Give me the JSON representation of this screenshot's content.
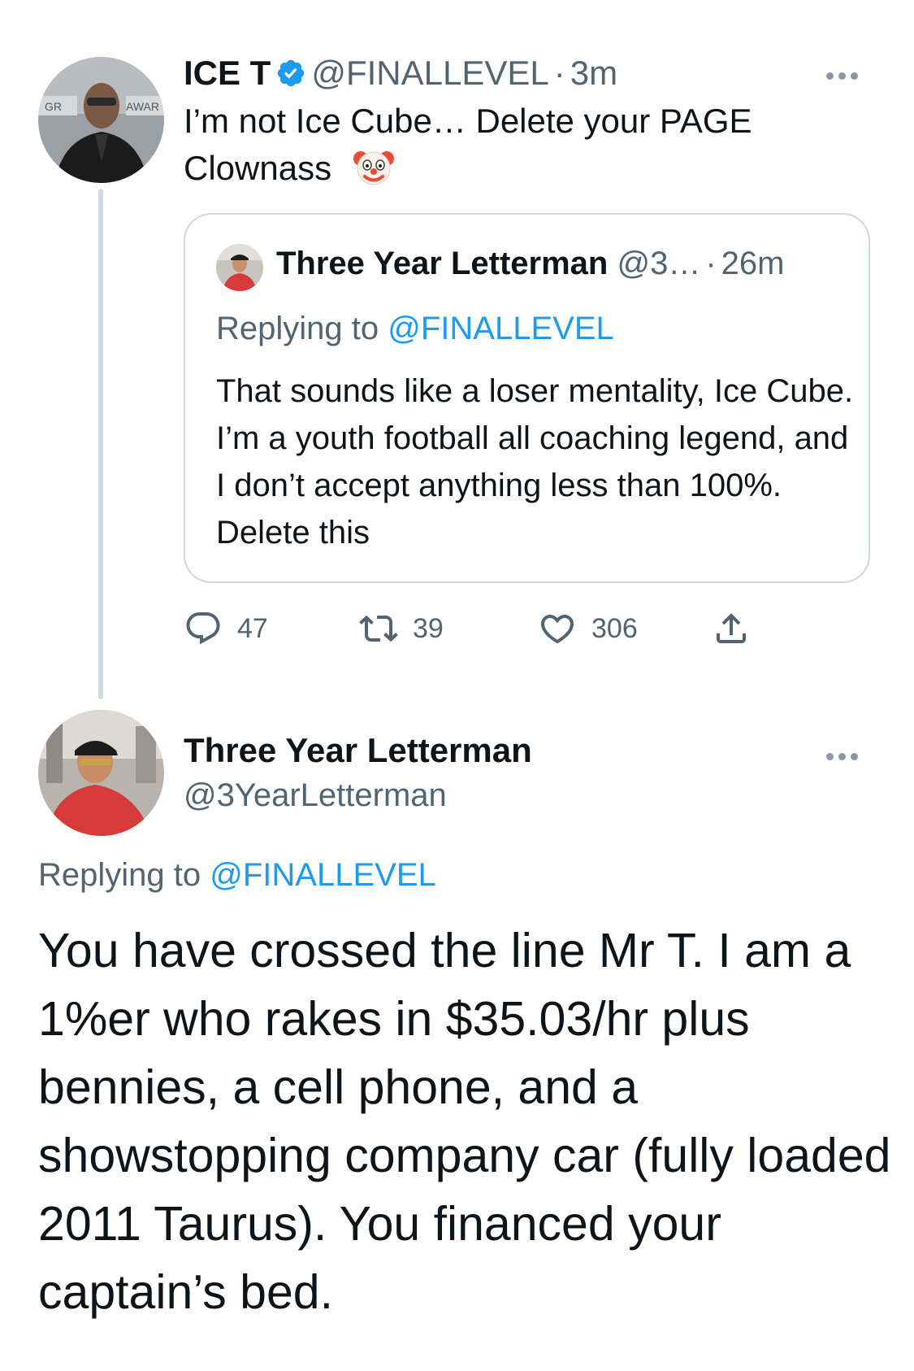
{
  "tweet": {
    "author_name": "ICE T",
    "author_handle": "@FINALLEVEL",
    "separator": "·",
    "time": "3m",
    "text": "I’m not Ice Cube… Delete your PAGE Clownass",
    "emoji": "🤡",
    "avatar_caption_left": "GR",
    "avatar_caption_right": "AWAR",
    "more_icon": "more-icon",
    "quoted": {
      "author_name": "Three Year Letterman",
      "author_handle": "@3…",
      "separator": "·",
      "time": "26m",
      "reply_prefix": "Replying to",
      "reply_handle": "@FINALLEVEL",
      "text": "That sounds like a loser mentality, Ice Cube. I’m a youth football all coaching legend, and I don’t accept anything less than 100%. Delete this"
    },
    "actions": {
      "reply_count": "47",
      "retweet_count": "39",
      "like_count": "306"
    }
  },
  "reply": {
    "author_name": "Three Year Letterman",
    "author_handle": "@3YearLetterman",
    "reply_prefix": "Replying to",
    "reply_handle": "@FINALLEVEL",
    "text": "You have crossed the line Mr T. I am a 1%er who rakes in $35.03/hr plus bennies, a cell phone, and a showstopping company car (fully loaded 2011 Taurus). You financed your captain’s bed."
  },
  "colors": {
    "link": "#1d9bf0",
    "muted": "#536471",
    "verified": "#1d9bf0",
    "thread_line": "#cfd9de"
  }
}
